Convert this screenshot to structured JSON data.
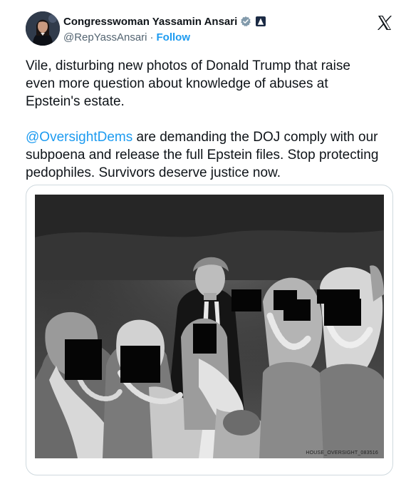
{
  "author": {
    "display_name": "Congresswoman Yassamin Ansari",
    "handle": "@RepYassAnsari",
    "separator": "·",
    "follow_label": "Follow",
    "verified_icon": "verified-badge-icon",
    "affiliation_icon": "government-badge-icon"
  },
  "header": {
    "logo_icon": "x-logo-icon"
  },
  "tweet": {
    "paragraph_1": "Vile, disturbing new photos of Donald Trump that raise even more question about knowledge of abuses at Epstein's estate.",
    "mention": "@OversightDems",
    "paragraph_2_rest": " are demanding the DOJ comply with our subpoena and release the full Epstein files. Stop protecting pedophiles. Survivors deserve justice now."
  },
  "media": {
    "photo_caption": "HOUSE_OVERSIGHT_083516"
  },
  "colors": {
    "accent": "#1d9bf0",
    "text": "#0f1419",
    "secondary_text": "#536471",
    "border": "#cfd9de"
  }
}
